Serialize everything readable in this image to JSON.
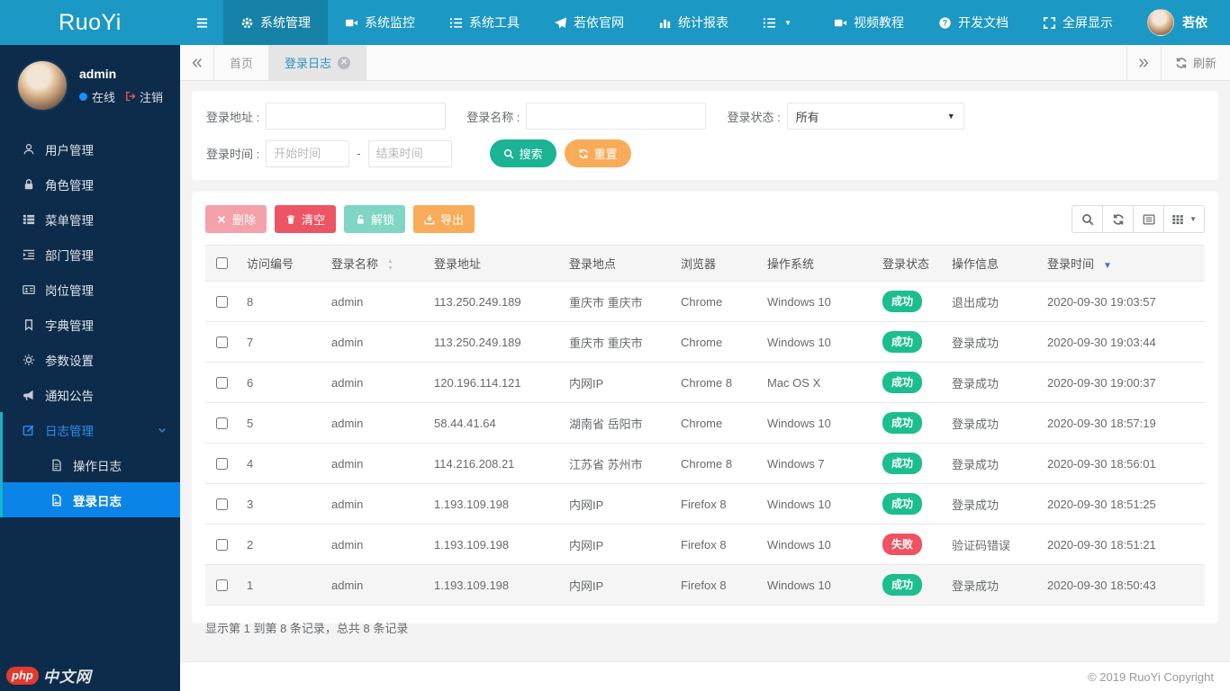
{
  "brand": "RuoYi",
  "navbar": {
    "items": [
      {
        "label": "系统管理",
        "icon": "gear",
        "active": true
      },
      {
        "label": "系统监控",
        "icon": "video",
        "active": false
      },
      {
        "label": "系统工具",
        "icon": "list",
        "active": false
      },
      {
        "label": "若依官网",
        "icon": "send",
        "active": false
      },
      {
        "label": "统计报表",
        "icon": "chart",
        "active": false
      },
      {
        "label": "",
        "icon": "list",
        "caret": true,
        "active": false
      }
    ],
    "right": [
      {
        "label": "视频教程",
        "icon": "video"
      },
      {
        "label": "开发文档",
        "icon": "question"
      },
      {
        "label": "全屏显示",
        "icon": "expand"
      },
      {
        "label": "若依",
        "icon": "avatar",
        "avatar": true
      }
    ]
  },
  "user": {
    "name": "admin",
    "status_text": "在线",
    "logout_text": "注销"
  },
  "sidebar": {
    "items": [
      {
        "label": "用户管理",
        "icon": "user"
      },
      {
        "label": "角色管理",
        "icon": "lock"
      },
      {
        "label": "菜单管理",
        "icon": "thlist"
      },
      {
        "label": "部门管理",
        "icon": "indent"
      },
      {
        "label": "岗位管理",
        "icon": "idcard"
      },
      {
        "label": "字典管理",
        "icon": "bookmark"
      },
      {
        "label": "参数设置",
        "icon": "sun"
      },
      {
        "label": "通知公告",
        "icon": "bullhorn"
      },
      {
        "label": "日志管理",
        "icon": "edit",
        "open": true,
        "children": [
          {
            "label": "操作日志",
            "icon": "filetext",
            "active": false
          },
          {
            "label": "登录日志",
            "icon": "fileimg",
            "active": true
          }
        ]
      }
    ]
  },
  "tabbar": {
    "home_tab": "首页",
    "active_tab": "登录日志",
    "refresh_label": "刷新"
  },
  "search": {
    "address_label": "登录地址 :",
    "name_label": "登录名称 :",
    "status_label": "登录状态 :",
    "status_value": "所有",
    "time_label": "登录时间 :",
    "start_placeholder": "开始时间",
    "end_placeholder": "结束时间",
    "range_separator": "-",
    "search_label": "搜索",
    "reset_label": "重置"
  },
  "toolbar": {
    "delete_label": "删除",
    "clear_label": "清空",
    "unlock_label": "解锁",
    "export_label": "导出"
  },
  "table": {
    "columns": [
      {
        "label": "访问编号",
        "sort": null
      },
      {
        "label": "登录名称",
        "sort": "both"
      },
      {
        "label": "登录地址",
        "sort": null
      },
      {
        "label": "登录地点",
        "sort": null
      },
      {
        "label": "浏览器",
        "sort": null
      },
      {
        "label": "操作系统",
        "sort": null
      },
      {
        "label": "登录状态",
        "sort": null
      },
      {
        "label": "操作信息",
        "sort": null
      },
      {
        "label": "登录时间",
        "sort": "desc"
      }
    ],
    "rows": [
      {
        "no": "8",
        "name": "admin",
        "address": "113.250.249.189",
        "location": "重庆市 重庆市",
        "browser": "Chrome",
        "os": "Windows 10",
        "status": "成功",
        "status_type": "success",
        "message": "退出成功",
        "time": "2020-09-30 19:03:57",
        "hover": false
      },
      {
        "no": "7",
        "name": "admin",
        "address": "113.250.249.189",
        "location": "重庆市 重庆市",
        "browser": "Chrome",
        "os": "Windows 10",
        "status": "成功",
        "status_type": "success",
        "message": "登录成功",
        "time": "2020-09-30 19:03:44",
        "hover": false
      },
      {
        "no": "6",
        "name": "admin",
        "address": "120.196.114.121",
        "location": "内网IP",
        "browser": "Chrome 8",
        "os": "Mac OS X",
        "status": "成功",
        "status_type": "success",
        "message": "登录成功",
        "time": "2020-09-30 19:00:37",
        "hover": false
      },
      {
        "no": "5",
        "name": "admin",
        "address": "58.44.41.64",
        "location": "湖南省 岳阳市",
        "browser": "Chrome",
        "os": "Windows 10",
        "status": "成功",
        "status_type": "success",
        "message": "登录成功",
        "time": "2020-09-30 18:57:19",
        "hover": false
      },
      {
        "no": "4",
        "name": "admin",
        "address": "114.216.208.21",
        "location": "江苏省 苏州市",
        "browser": "Chrome 8",
        "os": "Windows 7",
        "status": "成功",
        "status_type": "success",
        "message": "登录成功",
        "time": "2020-09-30 18:56:01",
        "hover": false
      },
      {
        "no": "3",
        "name": "admin",
        "address": "1.193.109.198",
        "location": "内网IP",
        "browser": "Firefox 8",
        "os": "Windows 10",
        "status": "成功",
        "status_type": "success",
        "message": "登录成功",
        "time": "2020-09-30 18:51:25",
        "hover": false
      },
      {
        "no": "2",
        "name": "admin",
        "address": "1.193.109.198",
        "location": "内网IP",
        "browser": "Firefox 8",
        "os": "Windows 10",
        "status": "失败",
        "status_type": "fail",
        "message": "验证码错误",
        "time": "2020-09-30 18:51:21",
        "hover": false
      },
      {
        "no": "1",
        "name": "admin",
        "address": "1.193.109.198",
        "location": "内网IP",
        "browser": "Firefox 8",
        "os": "Windows 10",
        "status": "成功",
        "status_type": "success",
        "message": "登录成功",
        "time": "2020-09-30 18:50:43",
        "hover": true
      }
    ]
  },
  "summary": "显示第 1 到第 8 条记录，总共 8 条记录",
  "footer": {
    "copyright": "© 2019 RuoYi Copyright"
  },
  "watermark": {
    "badge": "php",
    "text": "中文网"
  },
  "colors": {
    "navbar": "#1b98c3",
    "sidebar": "#0d2c4b",
    "sidebar_active": "#0b84e8",
    "submenu_accent": "#17b3c9",
    "primary": "#1ab394",
    "danger": "#ed5565",
    "warning": "#f8ac59",
    "badge_success": "#1cbe8f",
    "badge_fail": "#ef5261",
    "sort_active": "#5a68cf"
  }
}
